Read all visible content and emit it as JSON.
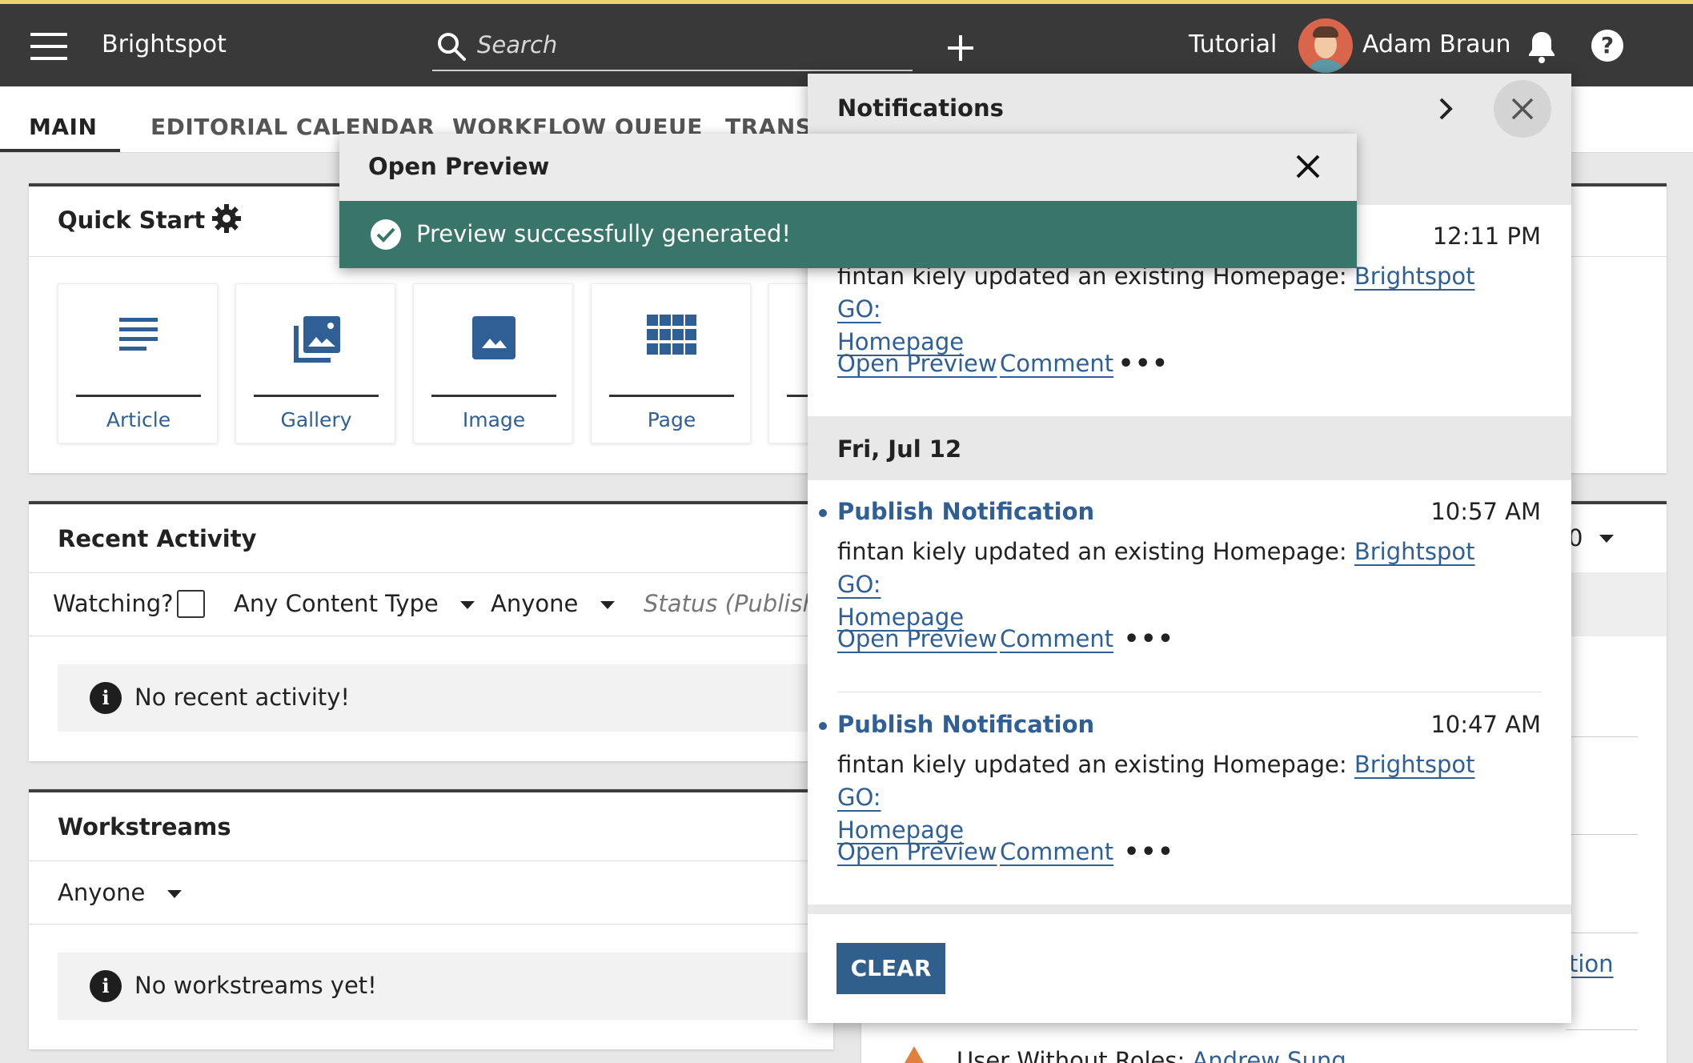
{
  "app": {
    "name": "Brightspot",
    "search_placeholder": "Search",
    "tutorial": "Tutorial",
    "user_name": "Adam Braun"
  },
  "tabs": [
    "MAIN",
    "EDITORIAL CALENDAR",
    "WORKFLOW QUEUE",
    "TRANSL"
  ],
  "quick_start": {
    "title": "Quick Start",
    "items": [
      {
        "label": "Article",
        "icon": "article-icon"
      },
      {
        "label": "Gallery",
        "icon": "gallery-icon"
      },
      {
        "label": "Image",
        "icon": "image-icon"
      },
      {
        "label": "Page",
        "icon": "grid-icon"
      }
    ]
  },
  "recent_activity": {
    "title": "Recent Activity",
    "watching_label": "Watching?",
    "content_type": "Any Content Type",
    "person": "Anyone",
    "status_placeholder": "Status (Publishe",
    "empty": "No recent activity!"
  },
  "workstreams": {
    "title": "Workstreams",
    "person": "Anyone",
    "empty": "No workstreams yet!"
  },
  "background_right": {
    "link_fragment": "tion",
    "digit_fragment": "0",
    "bottom_text": "User Without Roles:",
    "bottom_link": "Andrew Sung"
  },
  "notifications": {
    "title": "Notifications",
    "first": {
      "time": "12:11 PM",
      "text": "fintan kiely updated an existing Homepage:",
      "link1": "Brightspot GO:",
      "link2": "Homepage"
    },
    "date_header": "Fri, Jul 12",
    "items": [
      {
        "title": "Publish Notification",
        "time": "10:57 AM",
        "text": "fintan kiely updated an existing Homepage:",
        "link1": "Brightspot GO:",
        "link2": "Homepage"
      },
      {
        "title": "Publish Notification",
        "time": "10:47 AM",
        "text": "fintan kiely updated an existing Homepage:",
        "link1": "Brightspot GO:",
        "link2": "Homepage"
      }
    ],
    "action_preview": "Open Preview",
    "action_comment": "Comment",
    "more": "•••",
    "clear": "CLEAR"
  },
  "modal": {
    "title": "Open Preview",
    "message": "Preview successfully generated!"
  },
  "colors": {
    "topbar": "#3a3939",
    "accent_bar": "#e8d56a",
    "link": "#2f5f95",
    "success": "#3a7569",
    "clear_button": "#2f5f8a"
  }
}
